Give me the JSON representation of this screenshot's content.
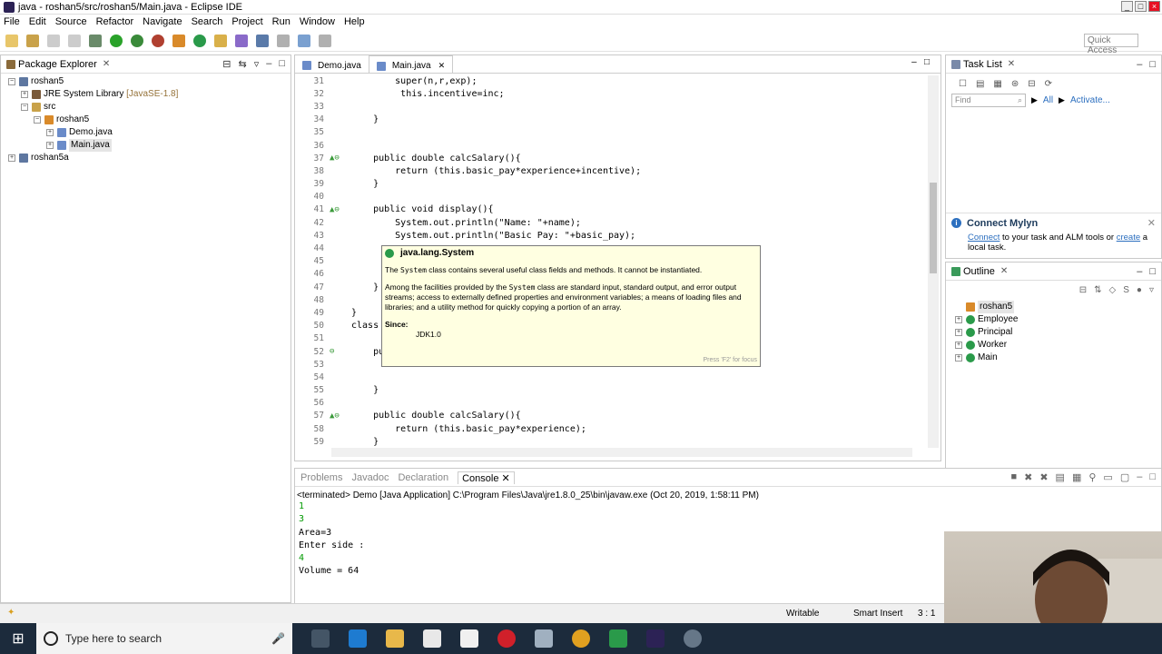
{
  "window": {
    "title": "java - roshan5/src/roshan5/Main.java - Eclipse IDE"
  },
  "menu": [
    "File",
    "Edit",
    "Source",
    "Refactor",
    "Navigate",
    "Search",
    "Project",
    "Run",
    "Window",
    "Help"
  ],
  "toolbar": {
    "quick_access": "Quick Access"
  },
  "package_explorer": {
    "title": "Package Explorer",
    "items": [
      {
        "label": "roshan5"
      },
      {
        "label": "JRE System Library",
        "extra": "[JavaSE-1.8]"
      },
      {
        "label": "src"
      },
      {
        "label": "roshan5"
      },
      {
        "label": "Demo.java"
      },
      {
        "label": "Main.java"
      },
      {
        "label": "roshan5a"
      }
    ]
  },
  "editor": {
    "tabs": [
      "Demo.java",
      "Main.java"
    ],
    "lines": [
      {
        "n": "31",
        "m": "",
        "t": "        super(n,r,exp);"
      },
      {
        "n": "32",
        "m": "",
        "t": "         this.incentive=inc;"
      },
      {
        "n": "33",
        "m": "",
        "t": ""
      },
      {
        "n": "34",
        "m": "",
        "t": "    }"
      },
      {
        "n": "35",
        "m": "",
        "t": ""
      },
      {
        "n": "36",
        "m": "",
        "t": ""
      },
      {
        "n": "37",
        "m": "▲⊖",
        "t": "    public double calcSalary(){"
      },
      {
        "n": "38",
        "m": "",
        "t": "        return (this.basic_pay*experience+incentive);"
      },
      {
        "n": "39",
        "m": "",
        "t": "    }"
      },
      {
        "n": "40",
        "m": "",
        "t": ""
      },
      {
        "n": "41",
        "m": "▲⊖",
        "t": "    public void display(){"
      },
      {
        "n": "42",
        "m": "",
        "t": "        System.out.println(\"Name: \"+name);"
      },
      {
        "n": "43",
        "m": "",
        "t": "        System.out.println(\"Basic Pay: \"+basic_pay);"
      },
      {
        "n": "44",
        "m": "",
        "t": ""
      },
      {
        "n": "45",
        "m": "",
        "t": ""
      },
      {
        "n": "46",
        "m": "",
        "t": ""
      },
      {
        "n": "47",
        "m": "",
        "t": "    }"
      },
      {
        "n": "48",
        "m": "",
        "t": ""
      },
      {
        "n": "49",
        "m": "",
        "t": "}"
      },
      {
        "n": "50",
        "m": "",
        "t": "class Wo"
      },
      {
        "n": "51",
        "m": "",
        "t": ""
      },
      {
        "n": "52",
        "m": "⊖",
        "t": "    publ"
      },
      {
        "n": "53",
        "m": "",
        "t": ""
      },
      {
        "n": "54",
        "m": "",
        "t": ""
      },
      {
        "n": "55",
        "m": "",
        "t": "    }"
      },
      {
        "n": "56",
        "m": "",
        "t": ""
      },
      {
        "n": "57",
        "m": "▲⊖",
        "t": "    public double calcSalary(){"
      },
      {
        "n": "58",
        "m": "",
        "t": "        return (this.basic_pay*experience);"
      },
      {
        "n": "59",
        "m": "",
        "t": "    }"
      }
    ]
  },
  "tooltip": {
    "title": "java.lang.System",
    "p1_before": "The ",
    "p1_code": "System",
    "p1_after": " class contains several useful class fields and methods. It cannot be instantiated.",
    "p2_before": "Among the facilities provided by the ",
    "p2_code": "System",
    "p2_after": " class are standard input, standard output, and error output streams; access to externally defined properties and environment variables; a means of loading files and libraries; and a utility method for quickly copying a portion of an array.",
    "since_label": "Since:",
    "since_value": "JDK1.0",
    "focus_hint": "Press 'F2' for focus"
  },
  "task_list": {
    "title": "Task List",
    "find_placeholder": "Find",
    "all": "All",
    "activate": "Activate..."
  },
  "mylyn": {
    "title": "Connect Mylyn",
    "connect": "Connect",
    "mid": " to your task and ALM tools or ",
    "create": "create",
    "end": " a local task."
  },
  "outline": {
    "title": "Outline",
    "items": [
      "roshan5",
      "Employee",
      "Principal",
      "Worker",
      "Main"
    ]
  },
  "console_panel": {
    "tabs": [
      "Problems",
      "Javadoc",
      "Declaration",
      "Console"
    ],
    "header": "<terminated> Demo [Java Application] C:\\Program Files\\Java\\jre1.8.0_25\\bin\\javaw.exe (Oct 20, 2019, 1:58:11 PM)",
    "lines": [
      {
        "text": "1",
        "input": true
      },
      {
        "text": "3",
        "input": true
      },
      {
        "text": "Area=3",
        "input": false
      },
      {
        "text": "Enter side :",
        "input": false
      },
      {
        "text": "4",
        "input": true
      },
      {
        "text": "Volume = 64",
        "input": false
      }
    ]
  },
  "status": {
    "writable": "Writable",
    "insert": "Smart Insert",
    "position": "3 : 1"
  },
  "taskbar": {
    "search_placeholder": "Type here to search"
  },
  "colors": {
    "accent": "#2c6fbf",
    "tooltip_bg": "#ffffe1",
    "taskbar": "#1c2b3c"
  }
}
